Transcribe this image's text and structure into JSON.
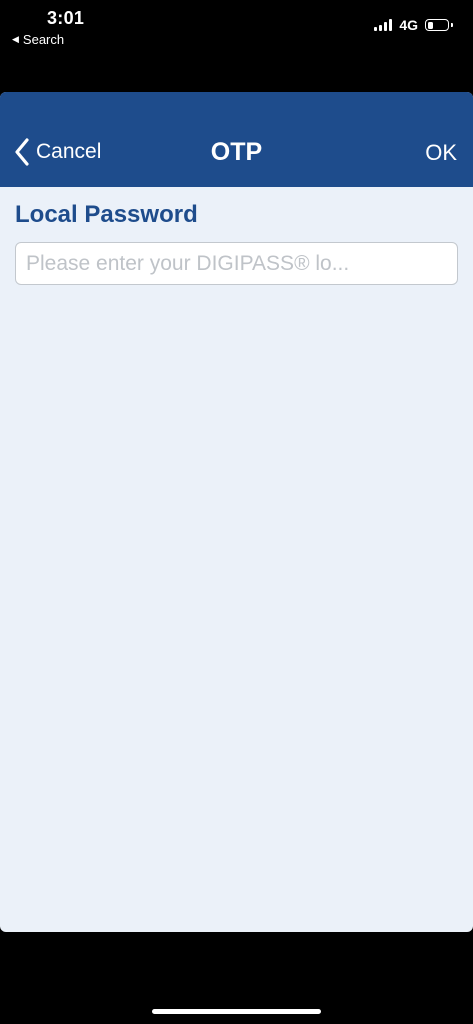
{
  "status_bar": {
    "time": "3:01",
    "back_label": "Search",
    "back_glyph": "◀",
    "network": "4G",
    "battery_level": 0.25
  },
  "navbar": {
    "cancel_label": "Cancel",
    "title": "OTP",
    "ok_label": "OK"
  },
  "form": {
    "field_label": "Local Password",
    "placeholder": "Please enter your DIGIPASS® lo...",
    "value": ""
  },
  "colors": {
    "nav_background": "#1e4c8c",
    "sheet_background": "#ebf1f9",
    "accent": "#1e4c8c"
  }
}
